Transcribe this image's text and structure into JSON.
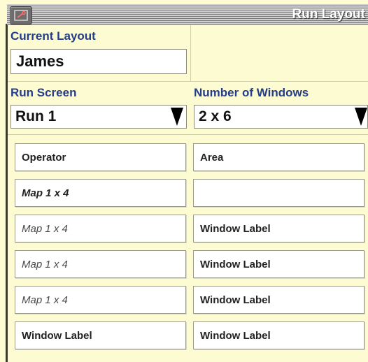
{
  "window": {
    "title": "Run Layout",
    "menu_icon": "wrench-icon"
  },
  "current_layout": {
    "label": "Current Layout",
    "value": "James"
  },
  "run_screen": {
    "label": "Run Screen",
    "value": "Run 1"
  },
  "number_of_windows": {
    "label": "Number of Windows",
    "value": "2 x 6"
  },
  "windows": {
    "left": [
      "Operator",
      "Map 1 x 4",
      "Map 1 x 4",
      "Map 1 x 4",
      "Map 1 x 4",
      "Window Label"
    ],
    "right": [
      "Area",
      "",
      "Window Label",
      "Window Label",
      "Window Label",
      "Window Label"
    ]
  },
  "colors": {
    "background": "#fcfbd2",
    "label": "#243d8a"
  }
}
